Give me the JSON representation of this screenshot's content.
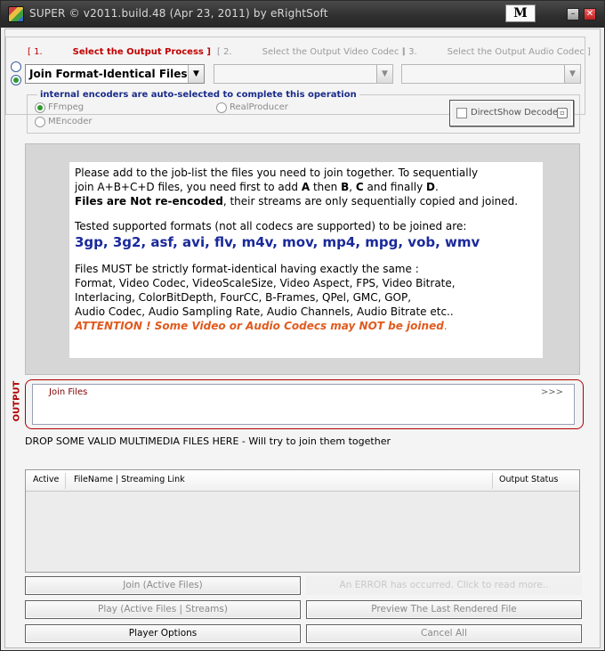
{
  "window": {
    "title": "SUPER © v2011.build.48 (Apr 23, 2011) by eRightSoft",
    "m_button": "M",
    "minimize_glyph": "–",
    "close_glyph": "✕"
  },
  "steps": {
    "step1": {
      "number": "[ 1.",
      "title": "Select the Output Process ]"
    },
    "step2": {
      "number": "[ 2.",
      "title": "Select the Output Video Codec ]"
    },
    "step3": {
      "number": "[ 3.",
      "title": "Select the Output Audio Codec ]"
    }
  },
  "process": {
    "selected": "Join Format-Identical Files"
  },
  "video_codec": {
    "selected": ""
  },
  "audio_codec": {
    "selected": ""
  },
  "encoders": {
    "title": "internal encoders are auto-selected to complete this operation",
    "ffmpeg": "FFmpeg",
    "mencoder": "MEncoder",
    "realproducer": "RealProducer",
    "directshow": "DirectShow Decode"
  },
  "info": {
    "para1_line1": "Please add to the job-list the files you need to join together.  To sequentially",
    "para1_line2_a": "join A+B+C+D files, you need first to add ",
    "para1_line2_b": "A",
    "para1_line2_c": " then ",
    "para1_line2_d": "B",
    "para1_line2_e": ", ",
    "para1_line2_f": "C",
    "para1_line2_g": " and finally ",
    "para1_line2_h": "D",
    "para1_line2_i": ".",
    "para1_line3_a": "Files are Not re-encoded",
    "para1_line3_b": ", their streams are only sequentially copied and joined.",
    "para2_line1": "Tested supported formats (not all codecs are supported) to be joined are:",
    "formats": "3gp, 3g2, asf, avi, flv, m4v, mov, mp4, mpg, vob, wmv",
    "para3_line1": "Files MUST be strictly format-identical having exactly the same :",
    "para3_line2": "Format, Video Codec, VideoScaleSize, Video Aspect, FPS, Video Bitrate,",
    "para3_line3": "Interlacing, ColorBitDepth, FourCC, B-Frames, QPel, GMC, GOP,",
    "para3_line4": "Audio Codec, Audio Sampling Rate, Audio Channels, Audio Bitrate etc..",
    "attention": "ATTENTION ! Some Video or Audio Codecs may NOT be joined",
    "attention_period": "."
  },
  "output": {
    "label": "OUTPUT",
    "value": "Join Files",
    "chevrons": ">>>"
  },
  "drop_text": "DROP SOME VALID MULTIMEDIA FILES HERE - Will try to join them together",
  "list": {
    "col_active": "Active",
    "col_filename": "FileName  |  Streaming Link",
    "col_status": "Output Status"
  },
  "buttons": {
    "join": "Join (Active Files)",
    "error_msg": "An ERROR has occurred. Click to read more..",
    "play": "Play (Active Files | Streams)",
    "preview": "Preview The Last Rendered File",
    "player_options": "Player Options",
    "cancel_all": "Cancel All"
  },
  "colors": {
    "accent_red": "#c00000",
    "format_blue": "#1a2a9a",
    "attention_orange": "#e05a1e"
  }
}
